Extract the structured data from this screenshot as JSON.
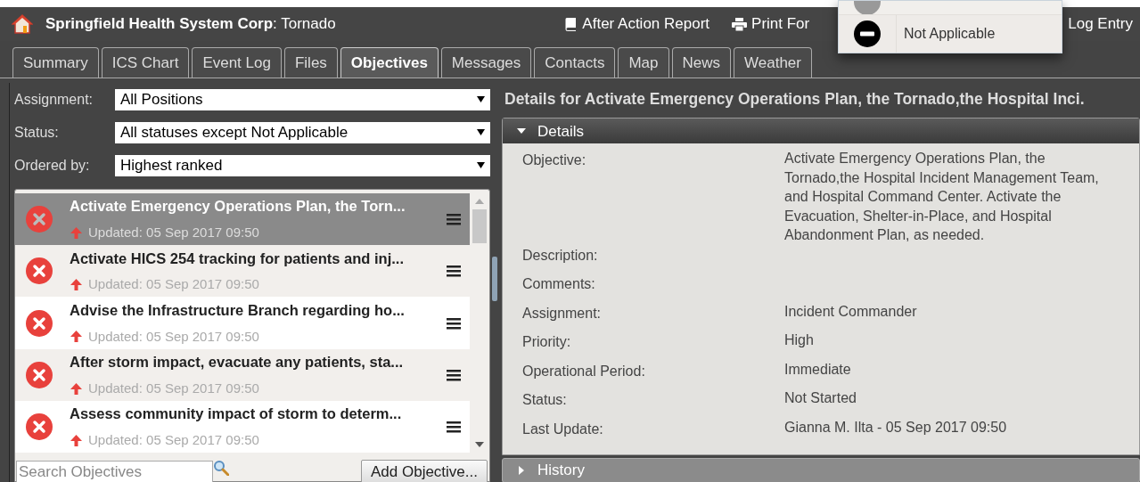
{
  "header": {
    "org": "Springfield Health System Corp",
    "incident": ": Tornado",
    "actions": [
      {
        "label": "After Action Report",
        "kind": "report"
      },
      {
        "label": "Print For",
        "kind": "print"
      },
      {
        "label": "Log Entry",
        "kind": "log"
      }
    ]
  },
  "status_menu": {
    "items": [
      {
        "label": "Not Applicable",
        "kind": "not_applicable"
      }
    ]
  },
  "tabs": [
    {
      "label": "Summary",
      "selected": false
    },
    {
      "label": "ICS Chart",
      "selected": false
    },
    {
      "label": "Event Log",
      "selected": false
    },
    {
      "label": "Files",
      "selected": false
    },
    {
      "label": "Objectives",
      "selected": true
    },
    {
      "label": "Messages",
      "selected": false
    },
    {
      "label": "Contacts",
      "selected": false
    },
    {
      "label": "Map",
      "selected": false
    },
    {
      "label": "News",
      "selected": false
    },
    {
      "label": "Weather",
      "selected": false
    }
  ],
  "filters": [
    {
      "label": "Assignment:",
      "value": "All Positions"
    },
    {
      "label": "Status:",
      "value": "All statuses except Not Applicable"
    },
    {
      "label": "Ordered by:",
      "value": "Highest ranked"
    }
  ],
  "objectives": [
    {
      "title": "Activate Emergency Operations Plan, the Torn...",
      "updated": "Updated: 05 Sep 2017 09:50",
      "selected": true
    },
    {
      "title": "Activate HICS 254 tracking for patients and inj...",
      "updated": "Updated: 05 Sep 2017 09:50",
      "selected": false
    },
    {
      "title": "Advise the Infrastructure Branch regarding ho...",
      "updated": "Updated: 05 Sep 2017 09:50",
      "selected": false
    },
    {
      "title": "After storm impact, evacuate any patients, sta...",
      "updated": "Updated: 05 Sep 2017 09:50",
      "selected": false
    },
    {
      "title": "Assess community impact of storm to determ...",
      "updated": "Updated: 05 Sep 2017 09:50",
      "selected": false
    }
  ],
  "search": {
    "placeholder": "Search Objectives"
  },
  "add_button": "Add Objective...",
  "details": {
    "title": "Details for Activate Emergency Operations Plan, the Tornado,the Hospital Inci.",
    "section": {
      "label": "Details",
      "expanded": true
    },
    "fields": [
      {
        "label": "Objective:",
        "value": "Activate Emergency Operations Plan, the Tornado,the Hospital Incident Management Team, and Hospital Command Center. Activate the Evacuation, Shelter-in-Place, and Hospital Abandonment Plan, as needed."
      },
      {
        "label": "Description:"
      },
      {
        "label": "Comments:"
      },
      {
        "label": "Assignment:",
        "value": "Incident Commander"
      },
      {
        "label": "Priority:",
        "value": "High"
      },
      {
        "label": "Operational Period:",
        "value": "Immediate"
      },
      {
        "label": "Status:",
        "value": "Not Started"
      },
      {
        "label": "Last Update:",
        "value": "Gianna M. Ilta - 05 Sep 2017 09:50"
      }
    ],
    "history": {
      "label": "History",
      "expanded": false
    }
  }
}
